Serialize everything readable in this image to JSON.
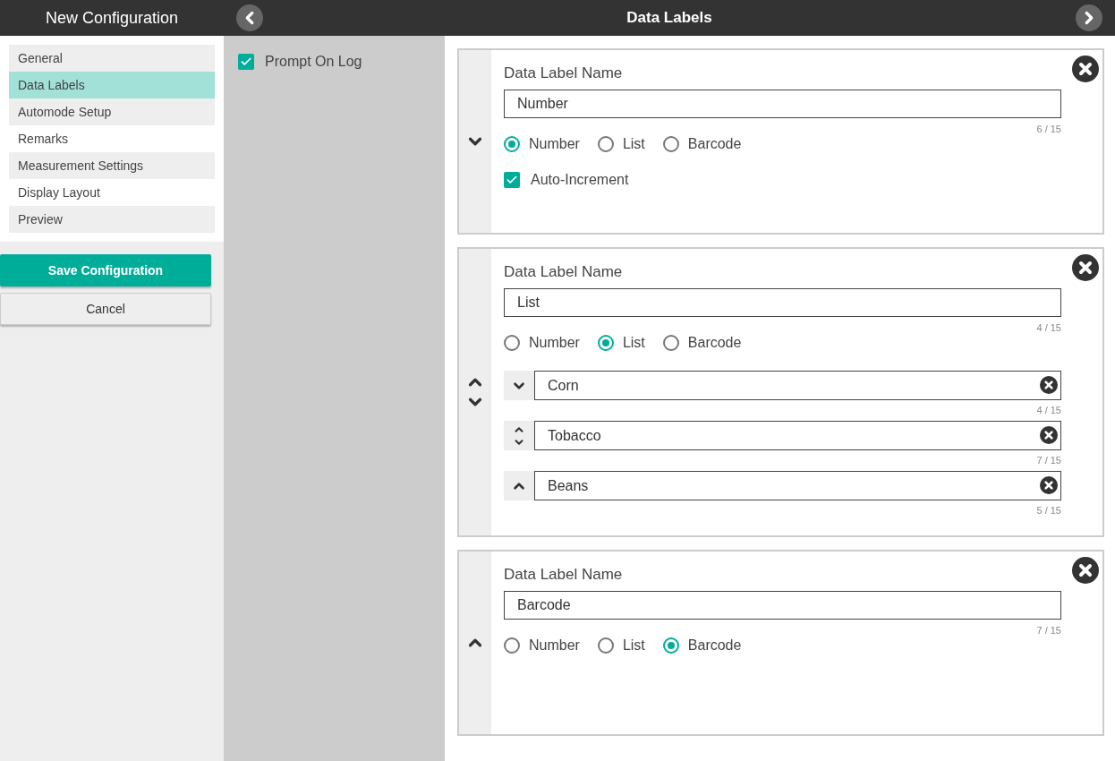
{
  "header": {
    "title": "New Configuration"
  },
  "sidebar": {
    "items": [
      {
        "label": "General",
        "selected": false
      },
      {
        "label": "Data Labels",
        "selected": true
      },
      {
        "label": "Automode Setup",
        "selected": false
      },
      {
        "label": "Remarks",
        "selected": false
      },
      {
        "label": "Measurement Settings",
        "selected": false
      },
      {
        "label": "Display Layout",
        "selected": false
      },
      {
        "label": "Preview",
        "selected": false
      }
    ]
  },
  "buttons": {
    "save": "Save Configuration",
    "cancel": "Cancel"
  },
  "topbar": {
    "title": "Data Labels"
  },
  "options": {
    "prompt_on_log": {
      "label": "Prompt On Log",
      "checked": true
    }
  },
  "labels": [
    {
      "kind": "number",
      "heading": "Data Label Name",
      "value": "Number",
      "counter": "6 / 15",
      "types": [
        {
          "label": "Number",
          "selected": true
        },
        {
          "label": "List",
          "selected": false
        },
        {
          "label": "Barcode",
          "selected": false
        }
      ],
      "auto_increment": {
        "label": "Auto-Increment",
        "checked": true
      }
    },
    {
      "kind": "list",
      "heading": "Data Label Name",
      "value": "List",
      "counter": "4 / 15",
      "types": [
        {
          "label": "Number",
          "selected": false
        },
        {
          "label": "List",
          "selected": true
        },
        {
          "label": "Barcode",
          "selected": false
        }
      ],
      "items": [
        {
          "value": "Corn",
          "counter": "4 / 15"
        },
        {
          "value": "Tobacco",
          "counter": "7 / 15"
        },
        {
          "value": "Beans",
          "counter": "5 / 15"
        }
      ]
    },
    {
      "kind": "barcode",
      "heading": "Data Label Name",
      "value": "Barcode",
      "counter": "7 / 15",
      "types": [
        {
          "label": "Number",
          "selected": false
        },
        {
          "label": "List",
          "selected": false
        },
        {
          "label": "Barcode",
          "selected": true
        }
      ]
    }
  ]
}
